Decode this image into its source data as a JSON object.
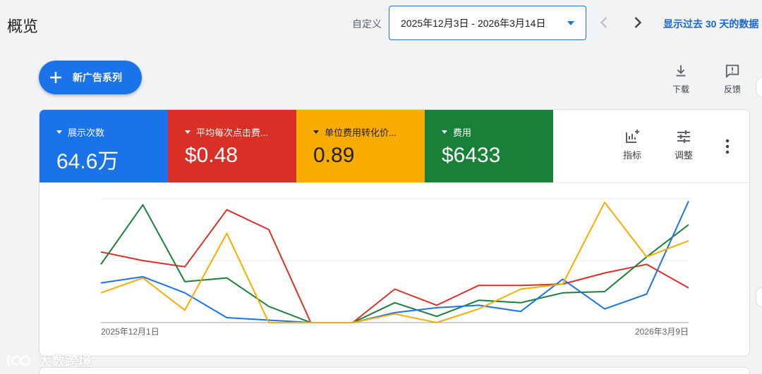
{
  "header": {
    "title": "概览",
    "date_label": "自定义",
    "date_range": "2025年12月3日 - 2026年3月14日",
    "last30": "显示过去 30 天的数据"
  },
  "actions": {
    "new_campaign": "新广告系列",
    "download": "下载",
    "feedback": "反馈"
  },
  "tiles": [
    {
      "name": "展示次数",
      "value": "64.6万",
      "color": "#1a73e8"
    },
    {
      "name": "平均每次点击费...",
      "value": "$0.48",
      "color": "#d93025"
    },
    {
      "name": "单位费用转化价...",
      "value": "0.89",
      "color": "#f9ab00"
    },
    {
      "name": "费用",
      "value": "$6433",
      "color": "#188038"
    }
  ],
  "card_tools": {
    "metrics": "指标",
    "adjust": "调整"
  },
  "watermark": "大数跨境",
  "chart_data": {
    "type": "line",
    "x_start_label": "2025年12月1日",
    "x_end_label": "2026年3月9日",
    "points": 15,
    "series": [
      {
        "color": "#d93025",
        "values": [
          0.57,
          0.5,
          0.45,
          0.91,
          0.75,
          0.0,
          0.0,
          0.27,
          0.14,
          0.3,
          0.3,
          0.31,
          0.4,
          0.47,
          0.28
        ]
      },
      {
        "color": "#188038",
        "values": [
          0.47,
          0.95,
          0.33,
          0.36,
          0.13,
          0.0,
          0.0,
          0.16,
          0.05,
          0.18,
          0.16,
          0.24,
          0.25,
          0.53,
          0.79
        ]
      },
      {
        "color": "#1a73e8",
        "values": [
          0.32,
          0.37,
          0.24,
          0.04,
          0.02,
          0.0,
          0.0,
          0.08,
          0.12,
          0.14,
          0.09,
          0.35,
          0.11,
          0.23,
          0.98
        ]
      },
      {
        "color": "#f9ab00",
        "values": [
          0.24,
          0.36,
          0.1,
          0.72,
          0.0,
          0.0,
          0.0,
          0.07,
          0.0,
          0.11,
          0.27,
          0.31,
          0.97,
          0.53,
          0.66
        ]
      }
    ]
  }
}
